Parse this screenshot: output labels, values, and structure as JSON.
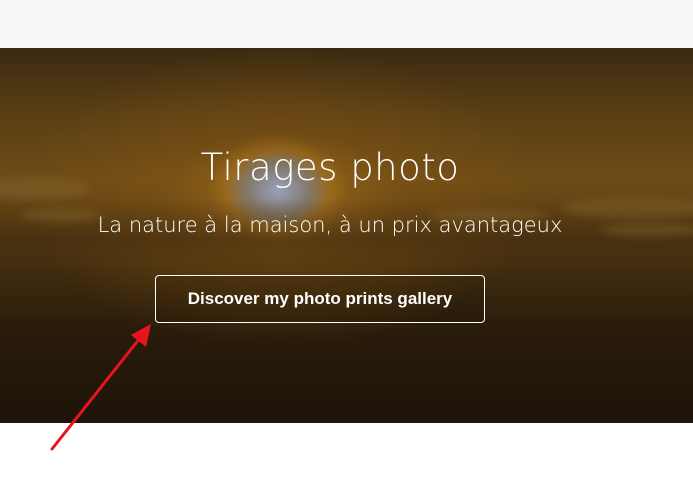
{
  "hero": {
    "title": "Tirages photo",
    "subtitle": "La nature à la maison, à un prix avantageux",
    "cta_label": "Discover my photo prints gallery"
  },
  "colors": {
    "annotation_arrow": "#e8141b",
    "text": "#ffffff",
    "top_bar": "#f6f6f6"
  },
  "icons": {
    "annotation": "red-arrow-icon"
  }
}
